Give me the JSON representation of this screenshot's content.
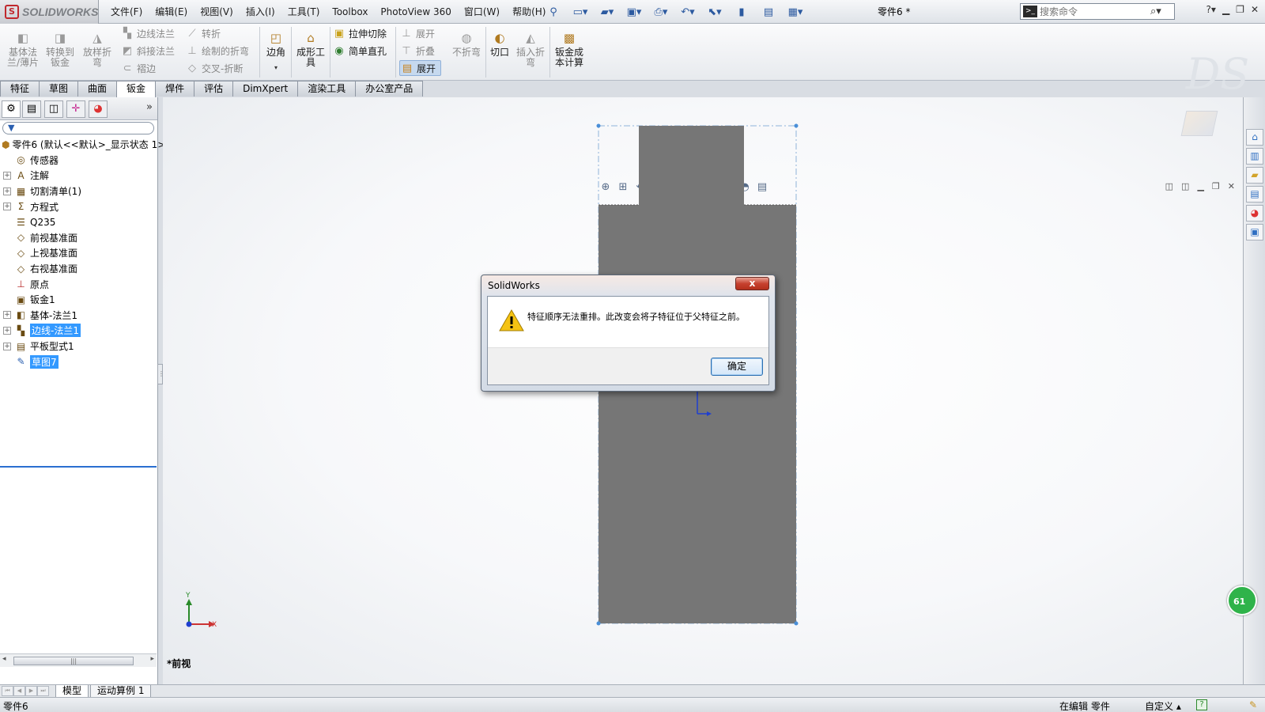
{
  "app": {
    "brand": "SOLIDWORKS",
    "logo_letter": "S",
    "document_title": "零件6 *"
  },
  "menu": [
    "文件(F)",
    "编辑(E)",
    "视图(V)",
    "插入(I)",
    "工具(T)",
    "Toolbox",
    "PhotoView 360",
    "窗口(W)",
    "帮助(H)"
  ],
  "search": {
    "placeholder": "搜索命令"
  },
  "ribbon": {
    "big": [
      {
        "label": "基体法\n兰/薄片",
        "icon": "base-flange-icon",
        "active": false
      },
      {
        "label": "转换到\n钣金",
        "icon": "convert-to-sheet-metal-icon",
        "active": false
      },
      {
        "label": "放样折\n弯",
        "icon": "lofted-bend-icon",
        "active": false
      },
      {
        "label": "边角",
        "icon": "corners-icon",
        "active": true
      },
      {
        "label": "成形工\n具",
        "icon": "forming-tool-icon",
        "active": true
      },
      {
        "label": "不折弯",
        "icon": "no-bends-icon",
        "active": false
      },
      {
        "label": "切口",
        "icon": "rip-icon",
        "active": true
      },
      {
        "label": "插入折\n弯",
        "icon": "insert-bends-icon",
        "active": false
      },
      {
        "label": "钣金成\n本计算",
        "icon": "sheet-metal-costing-icon",
        "active": true
      }
    ],
    "small": [
      {
        "label": "边线法兰",
        "active": false
      },
      {
        "label": "斜接法兰",
        "active": false
      },
      {
        "label": "褶边",
        "active": false
      },
      {
        "label": "转折",
        "active": false
      },
      {
        "label": "绘制的折弯",
        "active": false
      },
      {
        "label": "交叉-折断",
        "active": false
      },
      {
        "label": "拉伸切除",
        "active": true
      },
      {
        "label": "简单直孔",
        "active": true
      },
      {
        "label": "展开",
        "active": false
      },
      {
        "label": "折叠",
        "active": false
      },
      {
        "label": "展开",
        "active": true
      }
    ]
  },
  "tabs": [
    {
      "label": "特征",
      "active": false
    },
    {
      "label": "草图",
      "active": false
    },
    {
      "label": "曲面",
      "active": false
    },
    {
      "label": "钣金",
      "active": true
    },
    {
      "label": "焊件",
      "active": false
    },
    {
      "label": "评估",
      "active": false
    },
    {
      "label": "DimXpert",
      "active": false
    },
    {
      "label": "渲染工具",
      "active": false
    },
    {
      "label": "办公室产品",
      "active": false
    }
  ],
  "tree": [
    {
      "label": "零件6 (默认<<默认>_显示状态 1>)",
      "expand": "",
      "level": 0,
      "selected": false
    },
    {
      "label": "传感器",
      "expand": "none",
      "level": 1,
      "selected": false
    },
    {
      "label": "注解",
      "expand": "+",
      "level": 1,
      "selected": false
    },
    {
      "label": "切割清单(1)",
      "expand": "+",
      "level": 1,
      "selected": false
    },
    {
      "label": "方程式",
      "expand": "+",
      "level": 1,
      "selected": false
    },
    {
      "label": "Q235",
      "expand": "none",
      "level": 1,
      "selected": false
    },
    {
      "label": "前视基准面",
      "expand": "none",
      "level": 1,
      "selected": false
    },
    {
      "label": "上视基准面",
      "expand": "none",
      "level": 1,
      "selected": false
    },
    {
      "label": "右视基准面",
      "expand": "none",
      "level": 1,
      "selected": false
    },
    {
      "label": "原点",
      "expand": "none",
      "level": 1,
      "selected": false
    },
    {
      "label": "钣金1",
      "expand": "none",
      "level": 1,
      "selected": false
    },
    {
      "label": "基体-法兰1",
      "expand": "+",
      "level": 1,
      "selected": false
    },
    {
      "label": "边线-法兰1",
      "expand": "+",
      "level": 1,
      "selected": true
    },
    {
      "label": "平板型式1",
      "expand": "+",
      "level": 1,
      "selected": false
    },
    {
      "label": "草图7",
      "expand": "none",
      "level": 1,
      "selected": true
    }
  ],
  "viewport": {
    "view_label": "*前视",
    "axis_y": "Y",
    "axis_x": "X"
  },
  "bottom_tabs": [
    "模型",
    "运动算例 1"
  ],
  "status": {
    "left": "零件6",
    "mid": "在编辑 零件",
    "units": "自定义",
    "help": "?"
  },
  "badge": "61",
  "dialog": {
    "title": "SolidWorks",
    "close": "x",
    "message": "特征顺序无法重排。此改变会将子特征位于父特征之前。",
    "ok": "确定"
  }
}
